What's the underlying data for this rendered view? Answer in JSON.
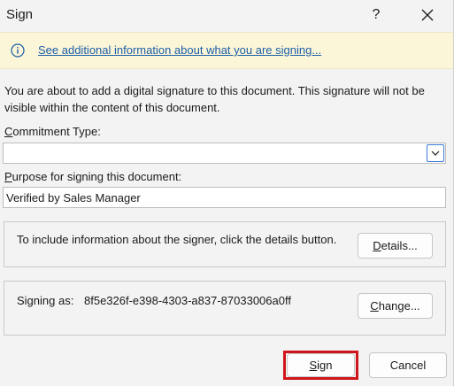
{
  "window": {
    "title": "Sign",
    "help_label": "?"
  },
  "infobar": {
    "link_text": "See additional information about what you are signing..."
  },
  "intro_text": "You are about to add a digital signature to this document. This signature will not be visible within the content of this document.",
  "commitment_type": {
    "label_accel": "C",
    "label_rest": "ommitment Type:",
    "value": ""
  },
  "purpose": {
    "label_accel": "P",
    "label_rest": "urpose for signing this document:",
    "value": "Verified by Sales Manager"
  },
  "details_group": {
    "text": "To include information about the signer, click the details button.",
    "button_accel": "D",
    "button_rest": "etails..."
  },
  "signing_group": {
    "signing_as_label": "Signing as:",
    "signer_id": "8f5e326f-e398-4303-a837-87033006a0ff",
    "button_accel": "C",
    "button_rest": "hange..."
  },
  "footer": {
    "sign_accel": "S",
    "sign_rest": "ign",
    "cancel_label": "Cancel"
  },
  "colors": {
    "highlight": "#d0141b",
    "link": "#1b5ea6",
    "infobar_bg": "#fcf6d8"
  }
}
